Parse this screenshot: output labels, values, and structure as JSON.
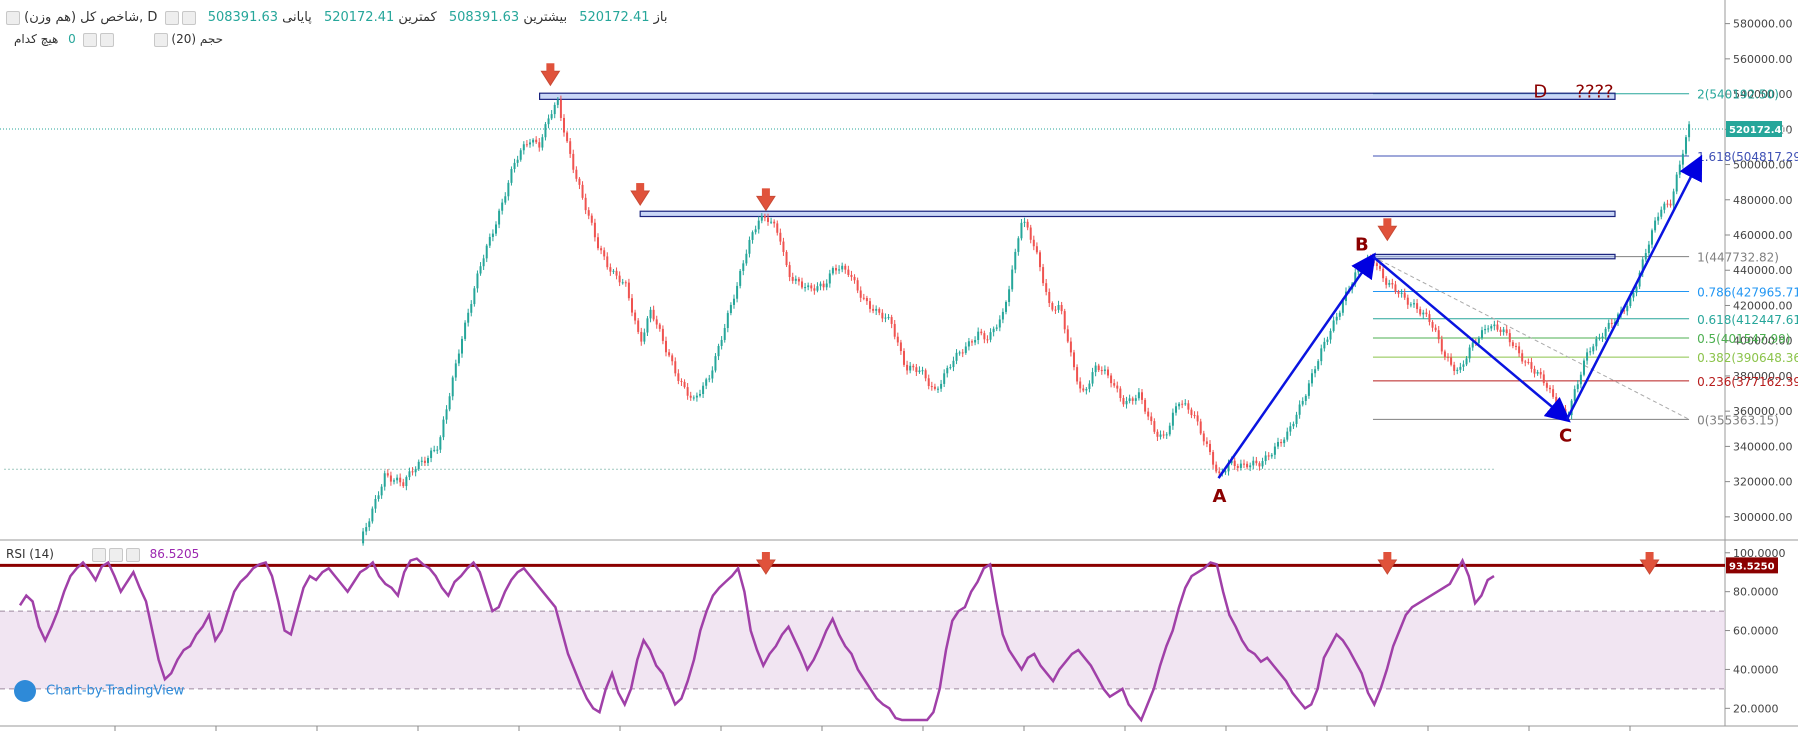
{
  "header": {
    "symbol": "شاخص کل (هم وزن), D",
    "open_label": "باز",
    "open_value": "508391.63",
    "high_label": "بیشترین",
    "high_value": "520172.41",
    "low_label": "کمترین",
    "low_value": "508391.63",
    "close_label": "پایانی",
    "close_value": "520172.41",
    "volume_label": "حجم (20)",
    "volume_none": "هیچ کدام",
    "volume_value": "0",
    "rsi_label": "RSI (14)",
    "rsi_value": "86.5205",
    "watermark": "Chart-by-TradingView",
    "up_color": "#26a69a",
    "down_color": "#ef5350"
  },
  "chart_data": [
    {
      "type": "candlestick",
      "title": "شاخص کل (هم وزن), D",
      "ylim": [
        288000,
        590000
      ],
      "y_ticks": [
        "580000.00",
        "560000.00",
        "540000.00",
        "520000.00",
        "500000.00",
        "480000.00",
        "460000.00",
        "440000.00",
        "420000.00",
        "400000.00",
        "380000.00",
        "360000.00",
        "340000.00",
        "320000.00",
        "300000.00"
      ],
      "y_tick_values": [
        580000,
        560000,
        540000,
        520000,
        500000,
        480000,
        460000,
        440000,
        420000,
        400000,
        380000,
        360000,
        340000,
        320000,
        300000
      ],
      "last_price_label": "520172.41",
      "last_price": 520172.41,
      "price_path": [
        {
          "t": 0.0,
          "v": 285000
        },
        {
          "t": 0.3,
          "v": 300000
        },
        {
          "t": 0.7,
          "v": 325000
        },
        {
          "t": 1.2,
          "v": 318000
        },
        {
          "t": 1.6,
          "v": 330000
        },
        {
          "t": 2.2,
          "v": 340000
        },
        {
          "t": 2.8,
          "v": 400000
        },
        {
          "t": 3.4,
          "v": 445000
        },
        {
          "t": 3.9,
          "v": 475000
        },
        {
          "t": 4.3,
          "v": 500000
        },
        {
          "t": 4.7,
          "v": 515000
        },
        {
          "t": 5.0,
          "v": 512000
        },
        {
          "t": 5.3,
          "v": 528000
        },
        {
          "t": 5.5,
          "v": 535000
        },
        {
          "t": 5.8,
          "v": 510000
        },
        {
          "t": 6.2,
          "v": 480000
        },
        {
          "t": 6.6,
          "v": 455000
        },
        {
          "t": 7.0,
          "v": 440000
        },
        {
          "t": 7.4,
          "v": 430000
        },
        {
          "t": 7.8,
          "v": 400000
        },
        {
          "t": 8.1,
          "v": 418000
        },
        {
          "t": 8.5,
          "v": 395000
        },
        {
          "t": 8.9,
          "v": 378000
        },
        {
          "t": 9.3,
          "v": 365000
        },
        {
          "t": 9.7,
          "v": 378000
        },
        {
          "t": 10.1,
          "v": 405000
        },
        {
          "t": 10.5,
          "v": 430000
        },
        {
          "t": 10.8,
          "v": 455000
        },
        {
          "t": 11.1,
          "v": 470000
        },
        {
          "t": 11.4,
          "v": 468000
        },
        {
          "t": 11.7,
          "v": 458000
        },
        {
          "t": 11.9,
          "v": 440000
        },
        {
          "t": 12.1,
          "v": 435000
        },
        {
          "t": 12.5,
          "v": 428000
        },
        {
          "t": 12.9,
          "v": 432000
        },
        {
          "t": 13.2,
          "v": 442000
        },
        {
          "t": 13.6,
          "v": 438000
        },
        {
          "t": 14.0,
          "v": 425000
        },
        {
          "t": 14.4,
          "v": 415000
        },
        {
          "t": 14.8,
          "v": 410000
        },
        {
          "t": 15.2,
          "v": 385000
        },
        {
          "t": 15.6,
          "v": 382000
        },
        {
          "t": 16.0,
          "v": 372000
        },
        {
          "t": 16.4,
          "v": 385000
        },
        {
          "t": 16.8,
          "v": 395000
        },
        {
          "t": 17.2,
          "v": 405000
        },
        {
          "t": 17.5,
          "v": 400000
        },
        {
          "t": 17.9,
          "v": 415000
        },
        {
          "t": 18.2,
          "v": 445000
        },
        {
          "t": 18.4,
          "v": 468000
        },
        {
          "t": 18.6,
          "v": 462000
        },
        {
          "t": 18.9,
          "v": 445000
        },
        {
          "t": 19.2,
          "v": 420000
        },
        {
          "t": 19.5,
          "v": 418000
        },
        {
          "t": 19.8,
          "v": 390000
        },
        {
          "t": 20.1,
          "v": 370000
        },
        {
          "t": 20.5,
          "v": 385000
        },
        {
          "t": 20.9,
          "v": 378000
        },
        {
          "t": 21.3,
          "v": 365000
        },
        {
          "t": 21.7,
          "v": 368000
        },
        {
          "t": 22.1,
          "v": 350000
        },
        {
          "t": 22.4,
          "v": 345000
        },
        {
          "t": 22.8,
          "v": 365000
        },
        {
          "t": 23.2,
          "v": 360000
        },
        {
          "t": 23.6,
          "v": 338000
        },
        {
          "t": 23.9,
          "v": 322000
        },
        {
          "t": 24.2,
          "v": 332000
        },
        {
          "t": 24.6,
          "v": 328000
        },
        {
          "t": 25.0,
          "v": 330000
        },
        {
          "t": 25.4,
          "v": 338000
        },
        {
          "t": 25.8,
          "v": 345000
        },
        {
          "t": 26.2,
          "v": 365000
        },
        {
          "t": 26.6,
          "v": 385000
        },
        {
          "t": 27.0,
          "v": 405000
        },
        {
          "t": 27.4,
          "v": 425000
        },
        {
          "t": 27.8,
          "v": 440000
        },
        {
          "t": 28.2,
          "v": 447732
        },
        {
          "t": 28.6,
          "v": 432000
        },
        {
          "t": 29.0,
          "v": 425000
        },
        {
          "t": 29.4,
          "v": 420000
        },
        {
          "t": 29.8,
          "v": 410000
        },
        {
          "t": 30.2,
          "v": 392000
        },
        {
          "t": 30.6,
          "v": 382000
        },
        {
          "t": 31.0,
          "v": 398000
        },
        {
          "t": 31.4,
          "v": 410000
        },
        {
          "t": 31.8,
          "v": 405000
        },
        {
          "t": 32.2,
          "v": 395000
        },
        {
          "t": 32.6,
          "v": 385000
        },
        {
          "t": 33.0,
          "v": 375000
        },
        {
          "t": 33.3,
          "v": 365000
        },
        {
          "t": 33.6,
          "v": 357000
        },
        {
          "t": 33.9,
          "v": 375000
        },
        {
          "t": 34.2,
          "v": 395000
        },
        {
          "t": 34.6,
          "v": 405000
        },
        {
          "t": 35.0,
          "v": 412000
        },
        {
          "t": 35.4,
          "v": 425000
        },
        {
          "t": 35.8,
          "v": 450000
        },
        {
          "t": 36.2,
          "v": 475000
        },
        {
          "t": 36.5,
          "v": 480000
        },
        {
          "t": 36.8,
          "v": 505000
        },
        {
          "t": 37.0,
          "v": 520172
        }
      ],
      "fib_levels": [
        {
          "label": "2(540192.50)",
          "value": 540192.5,
          "color": "#26a69a"
        },
        {
          "label": "1.618(504817.29)",
          "value": 504817.29,
          "color": "#3f51b5"
        },
        {
          "label": "1(447732.82)",
          "value": 447732.82,
          "color": "#808080"
        },
        {
          "label": "0.786(427965.71)",
          "value": 427965.71,
          "color": "#2196f3"
        },
        {
          "label": "0.618(412447.61)",
          "value": 412447.61,
          "color": "#26a69a"
        },
        {
          "label": "0.5(401547.99)",
          "value": 401547.99,
          "color": "#4caf50"
        },
        {
          "label": "0.382(390648.36)",
          "value": 390648.36,
          "color": "#8bc34a"
        },
        {
          "label": "0.236(377162.39)",
          "value": 377162.39,
          "color": "#b71c1c"
        },
        {
          "label": "0(355363.15)",
          "value": 355363.15,
          "color": "#808080"
        }
      ],
      "points": [
        {
          "label": "A",
          "t": 23.9,
          "v": 322000
        },
        {
          "label": "B",
          "t": 28.2,
          "v": 447732.82
        },
        {
          "label": "C",
          "t": 33.6,
          "v": 355363.15
        },
        {
          "label": "D",
          "t": 33.0,
          "v": 540192.5
        }
      ],
      "question_label": "????",
      "resistance_zones": [
        {
          "name": "top-zone",
          "t0": 5.0,
          "t1": 37.0,
          "low": 537000,
          "high": 540500
        },
        {
          "name": "mid-zone",
          "t0": 7.8,
          "t1": 37.0,
          "low": 470500,
          "high": 473500
        },
        {
          "name": "b-zone",
          "t0": 28.2,
          "t1": 37.0,
          "low": 446500,
          "high": 449000
        }
      ],
      "support_level": 327000,
      "arrows_markers": [
        {
          "t": 5.3,
          "v": 545000
        },
        {
          "t": 7.8,
          "v": 477000
        },
        {
          "t": 11.3,
          "v": 474000
        },
        {
          "t": 28.6,
          "v": 457000
        }
      ]
    },
    {
      "type": "line",
      "title": "RSI (14)",
      "ylim": [
        14,
        104
      ],
      "y_ticks": [
        "100.0000",
        "80.0000",
        "60.0000",
        "40.0000",
        "20.0000"
      ],
      "y_tick_values": [
        100,
        80,
        60,
        40,
        20
      ],
      "band": [
        30,
        70
      ],
      "overbought_line": 93.525,
      "overbought_label": "93.5250",
      "series": [
        {
          "values": [
            73,
            78,
            75,
            62,
            55,
            62,
            70,
            80,
            88,
            92,
            95,
            91,
            86,
            93,
            95,
            88,
            80,
            85,
            90,
            82,
            75,
            60,
            45,
            35,
            38,
            45,
            50,
            52,
            58,
            62,
            68,
            55,
            60,
            70,
            80,
            85,
            88,
            92,
            94,
            95,
            88,
            75,
            60,
            58,
            70,
            82,
            88,
            86,
            90,
            92,
            88,
            84,
            80,
            85,
            90,
            92,
            95,
            88,
            84,
            82,
            78,
            90,
            96,
            97,
            94,
            92,
            88,
            82,
            78,
            85,
            88,
            92,
            95,
            90,
            80,
            70,
            72,
            80,
            86,
            90,
            92,
            88,
            84,
            80,
            76,
            72,
            60,
            48,
            40,
            32,
            25,
            20,
            18,
            30,
            38,
            28,
            22,
            30,
            45,
            55,
            50,
            42,
            38,
            30,
            22,
            25,
            34,
            45,
            60,
            70,
            78,
            82,
            85,
            88,
            92,
            80,
            60,
            50,
            42,
            48,
            52,
            58,
            62,
            55,
            48,
            40,
            45,
            52,
            60,
            66,
            58,
            52,
            48,
            40,
            35,
            30,
            25,
            22,
            20,
            15,
            12,
            14,
            10,
            8,
            12,
            18,
            30,
            50,
            65,
            70,
            72,
            80,
            85,
            92,
            94,
            75,
            58,
            50,
            45,
            40,
            46,
            48,
            42,
            38,
            34,
            40,
            44,
            48,
            50,
            46,
            42,
            36,
            30,
            26,
            28,
            30,
            22,
            18,
            14,
            22,
            30,
            42,
            52,
            60,
            72,
            82,
            88,
            90,
            92,
            95,
            94,
            80,
            68,
            62,
            55,
            50,
            48,
            44,
            46,
            42,
            38,
            34,
            28,
            24,
            20,
            22,
            30,
            46,
            52,
            58,
            55,
            50,
            44,
            38,
            28,
            22,
            30,
            40,
            52,
            60,
            68,
            72,
            74,
            76,
            78,
            80,
            82,
            84,
            90,
            96,
            88,
            74,
            78,
            86,
            88
          ]
        }
      ],
      "markers_t": [
        0.505,
        0.667,
        0.811
      ]
    }
  ]
}
